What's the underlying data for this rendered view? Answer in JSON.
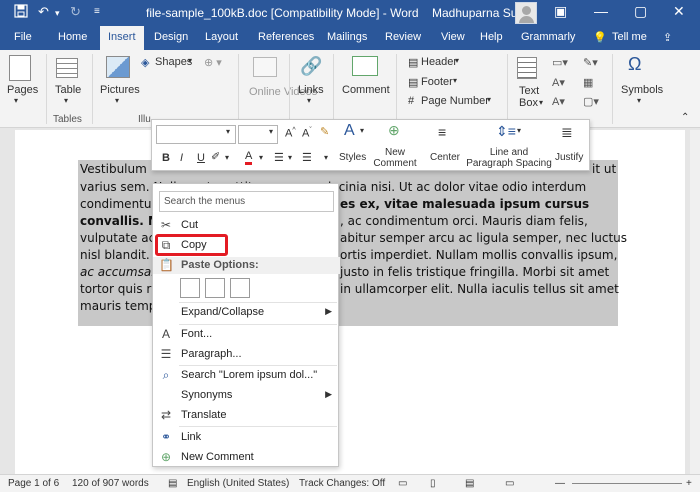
{
  "window": {
    "title": "file-sample_100kB.doc [Compatibility Mode] - Word",
    "user_name": "Madhuparna Sukul",
    "qa_icons": [
      "save-icon",
      "undo-icon",
      "redo-icon"
    ]
  },
  "tabs": [
    "File",
    "Home",
    "Insert",
    "Design",
    "Layout",
    "References",
    "Mailings",
    "Review",
    "View",
    "Help",
    "Grammarly",
    "Tell me"
  ],
  "active_tab": "Insert",
  "ribbon": {
    "pages": "Pages",
    "table": "Table",
    "tables_group": "Tables",
    "pictures": "Pictures",
    "illustrations_group": "Illu",
    "shapes": "Shapes",
    "online_videos": "Online Videos",
    "links": "Links",
    "comment": "Comment",
    "header": "Header",
    "footer": "Footer",
    "page_number": "Page Number",
    "text_box": "Text Box",
    "symbols": "Symbols"
  },
  "document": {
    "lines": [
      "Vestibulum",
      "varius sem. Nullam at porttitor arcu, nec lacinia nisi. Ut ac dolor vitae odio interdum",
      "condimentum",
      "convallis. M",
      "vulputate ac",
      "nisl blandit.",
      "ac accumsan",
      "tortor quis ri",
      "mauris temp"
    ],
    "right_fragments": [
      "it ut",
      "es ex, vitae malesuada ipsum cursus",
      ", ac condimentum orci. Mauris diam felis,",
      "abitur semper arcu ac ligula semper, nec luctus",
      "ortis imperdiet. Nullam mollis convallis ipsum,",
      "justo in felis tristique fringilla. Morbi sit amet",
      "in ullamcorper elit. Nulla iaculis tellus sit amet"
    ]
  },
  "mini_toolbar": {
    "styles": "Styles",
    "new_comment": "New Comment",
    "center": "Center",
    "line_spacing": "Line and Paragraph Spacing",
    "justify": "Justify",
    "bold": "B",
    "italic": "I",
    "underline": "U"
  },
  "context_menu": {
    "search_placeholder": "Search the menus",
    "items": {
      "cut": "Cut",
      "copy": "Copy",
      "paste_options": "Paste Options:",
      "expand_collapse": "Expand/Collapse",
      "font": "Font...",
      "paragraph": "Paragraph...",
      "search": "Search \"Lorem ipsum dol...\"",
      "synonyms": "Synonyms",
      "translate": "Translate",
      "link": "Link",
      "new_comment": "New Comment"
    }
  },
  "status_bar": {
    "page": "Page 1 of 6",
    "words": "120 of 907 words",
    "language": "English (United States)",
    "track_changes": "Track Changes: Off"
  },
  "colors": {
    "brand": "#2b579a",
    "highlight_border": "#e31b23"
  }
}
